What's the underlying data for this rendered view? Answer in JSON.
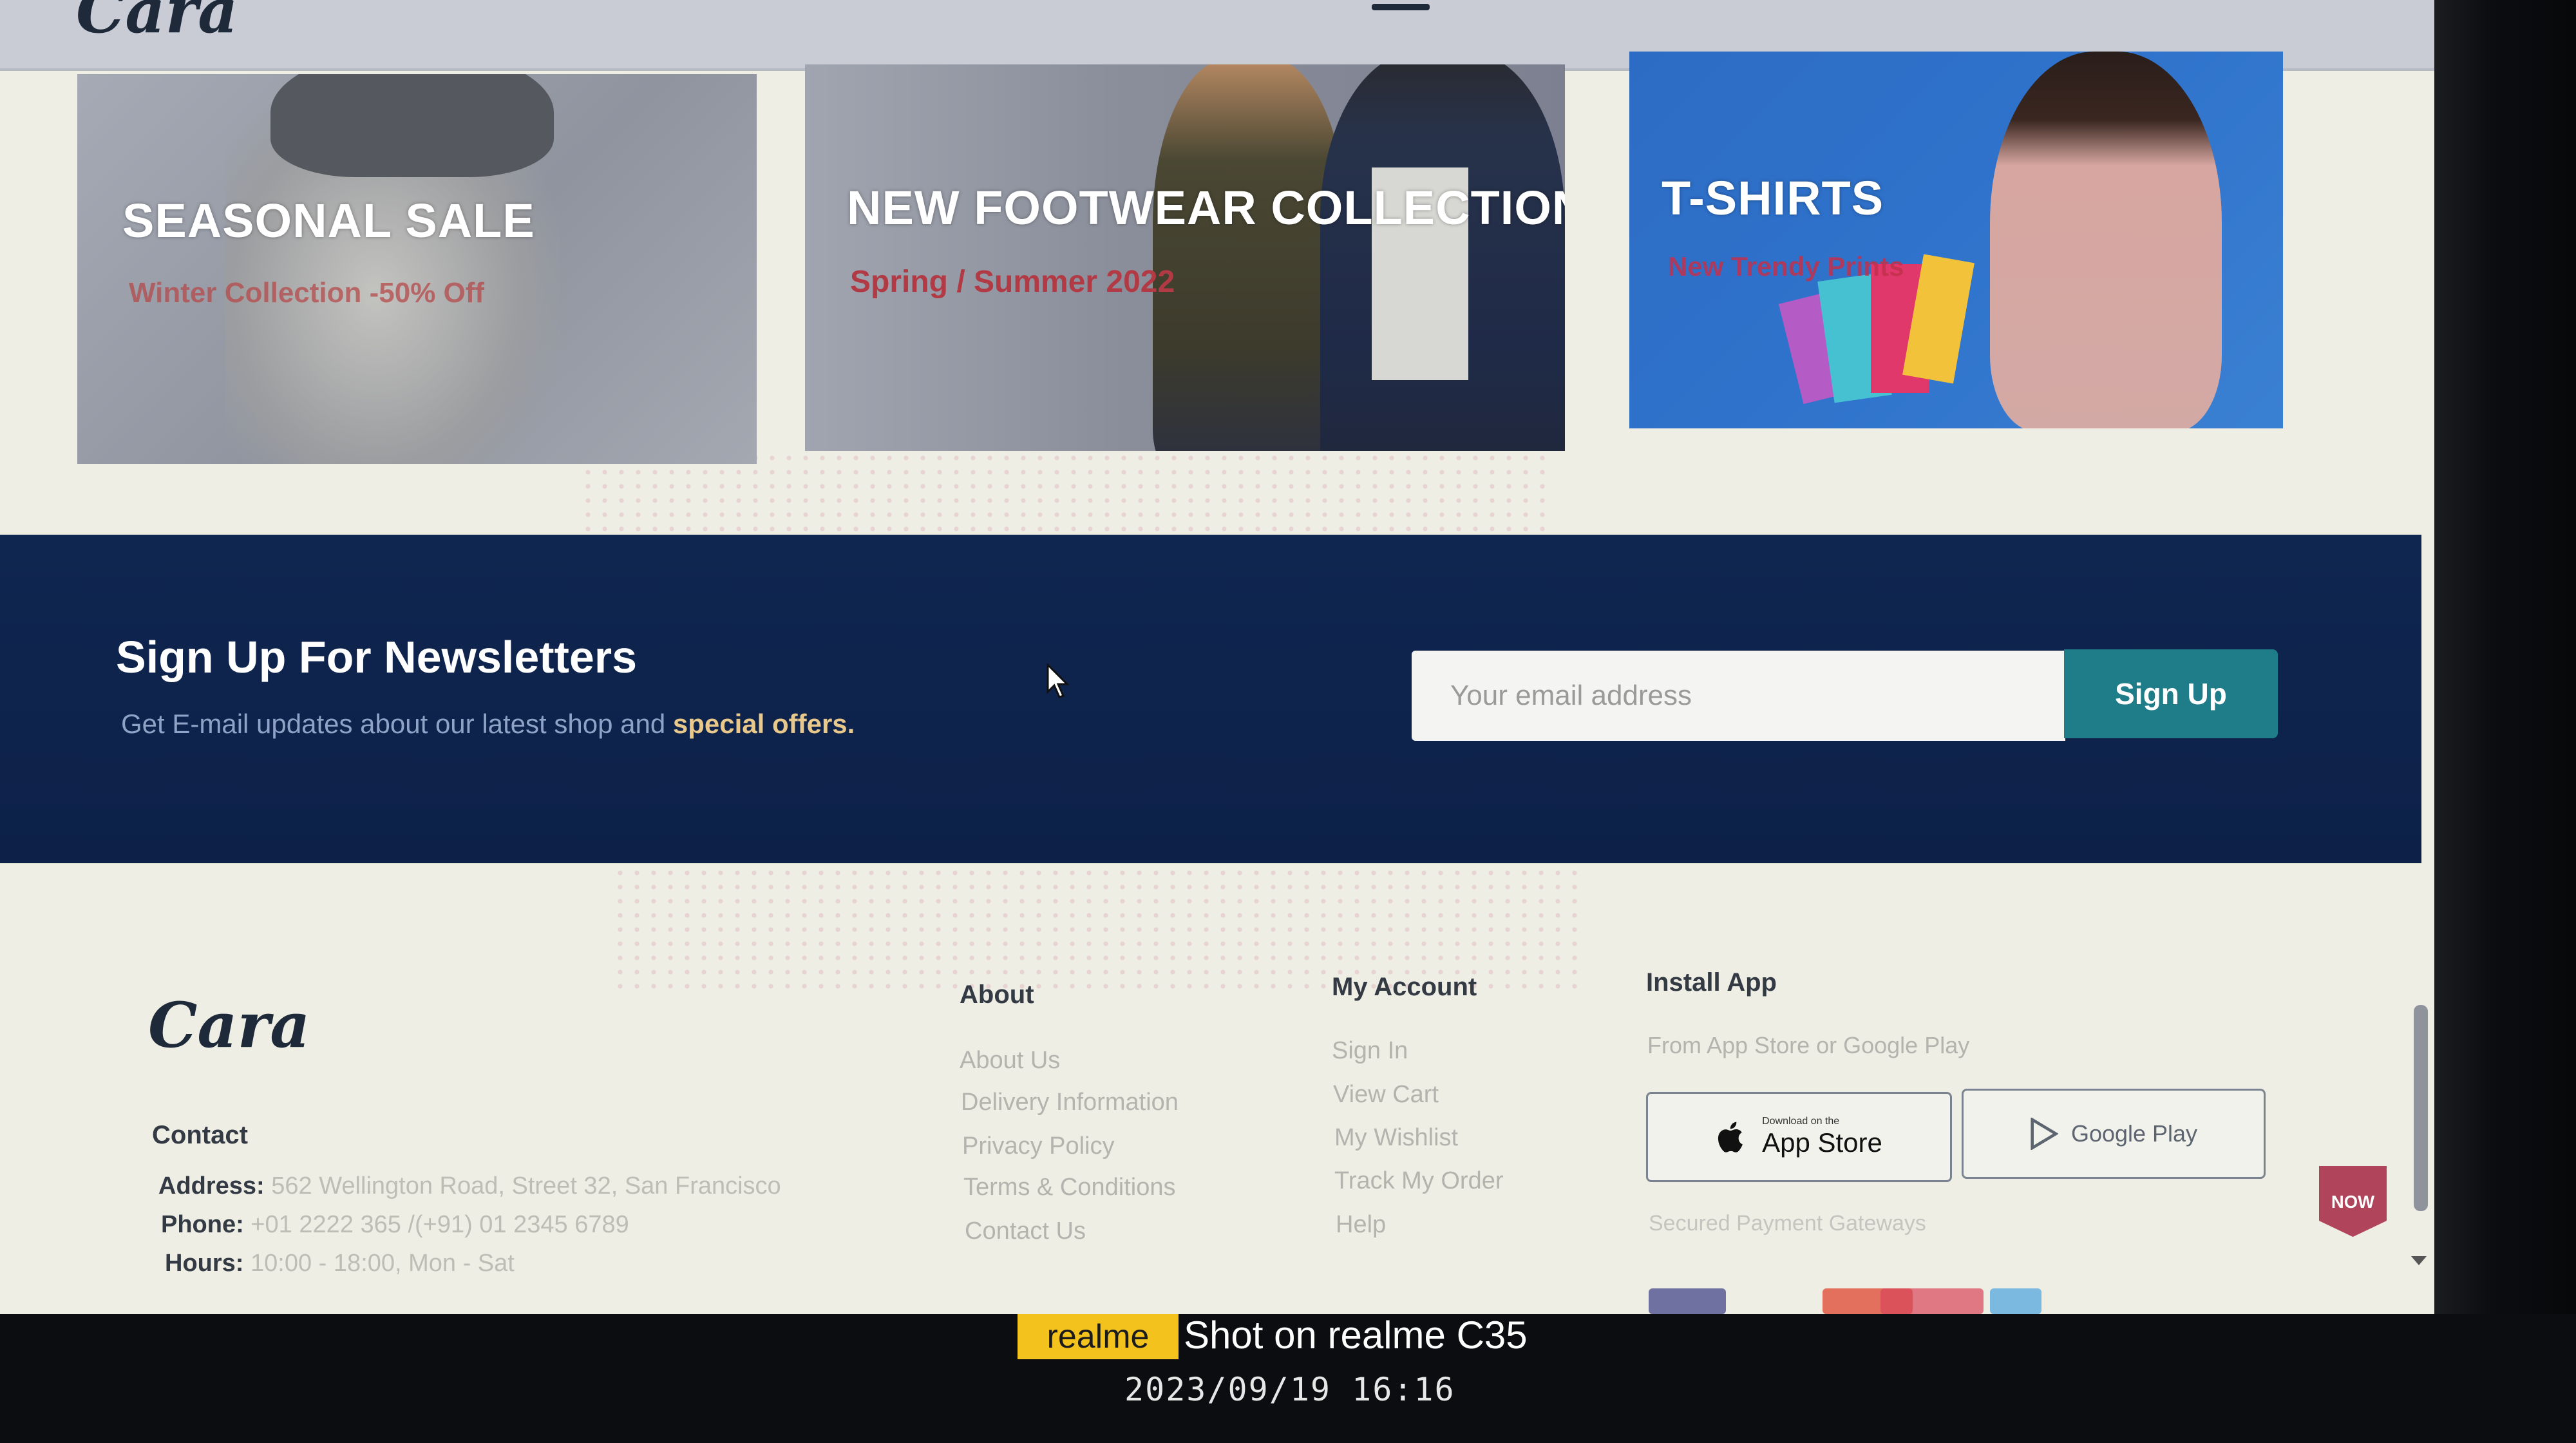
{
  "header": {
    "logo": "Cara"
  },
  "banners": [
    {
      "title": "SEASONAL SALE",
      "subtitle": "Winter Collection -50% Off"
    },
    {
      "title": "NEW FOOTWEAR COLLECTION",
      "subtitle": "Spring / Summer 2022"
    },
    {
      "title": "T-SHIRTS",
      "subtitle": "New Trendy Prints"
    }
  ],
  "newsletter": {
    "title": "Sign Up For Newsletters",
    "subtitle_prefix": "Get E-mail updates about our latest shop and ",
    "subtitle_highlight": "special offers.",
    "email_placeholder": "Your email address",
    "signup_label": "Sign Up"
  },
  "footer": {
    "logo": "Cara",
    "contact": {
      "heading": "Contact",
      "address_label": "Address:",
      "address_value": "562 Wellington Road, Street 32, San Francisco",
      "phone_label": "Phone:",
      "phone_value": "+01 2222 365 /(+91) 01 2345 6789",
      "hours_label": "Hours:",
      "hours_value": "10:00 - 18:00, Mon - Sat"
    },
    "about": {
      "heading": "About",
      "links": [
        "About Us",
        "Delivery Information",
        "Privacy Policy",
        "Terms & Conditions",
        "Contact Us"
      ]
    },
    "my_account": {
      "heading": "My Account",
      "links": [
        "Sign In",
        "View Cart",
        "My Wishlist",
        "Track My Order",
        "Help"
      ]
    },
    "install_app": {
      "heading": "Install App",
      "text": "From App Store or Google Play",
      "app_store_small": "Download on the",
      "app_store_big": "App Store",
      "google_play": "Google Play",
      "payment_text": "Secured Payment Gateways"
    },
    "subscribe_badge": "NOW"
  },
  "watermark": {
    "brand": "realme",
    "text": "Shot on realme C35",
    "datetime": "2023/09/19  16:16"
  },
  "colors": {
    "newsletter_bg": "#0f2650",
    "signup_button": "#1f7d89",
    "highlight": "#e9c98b",
    "watermark_brand": "#f4c21d"
  }
}
